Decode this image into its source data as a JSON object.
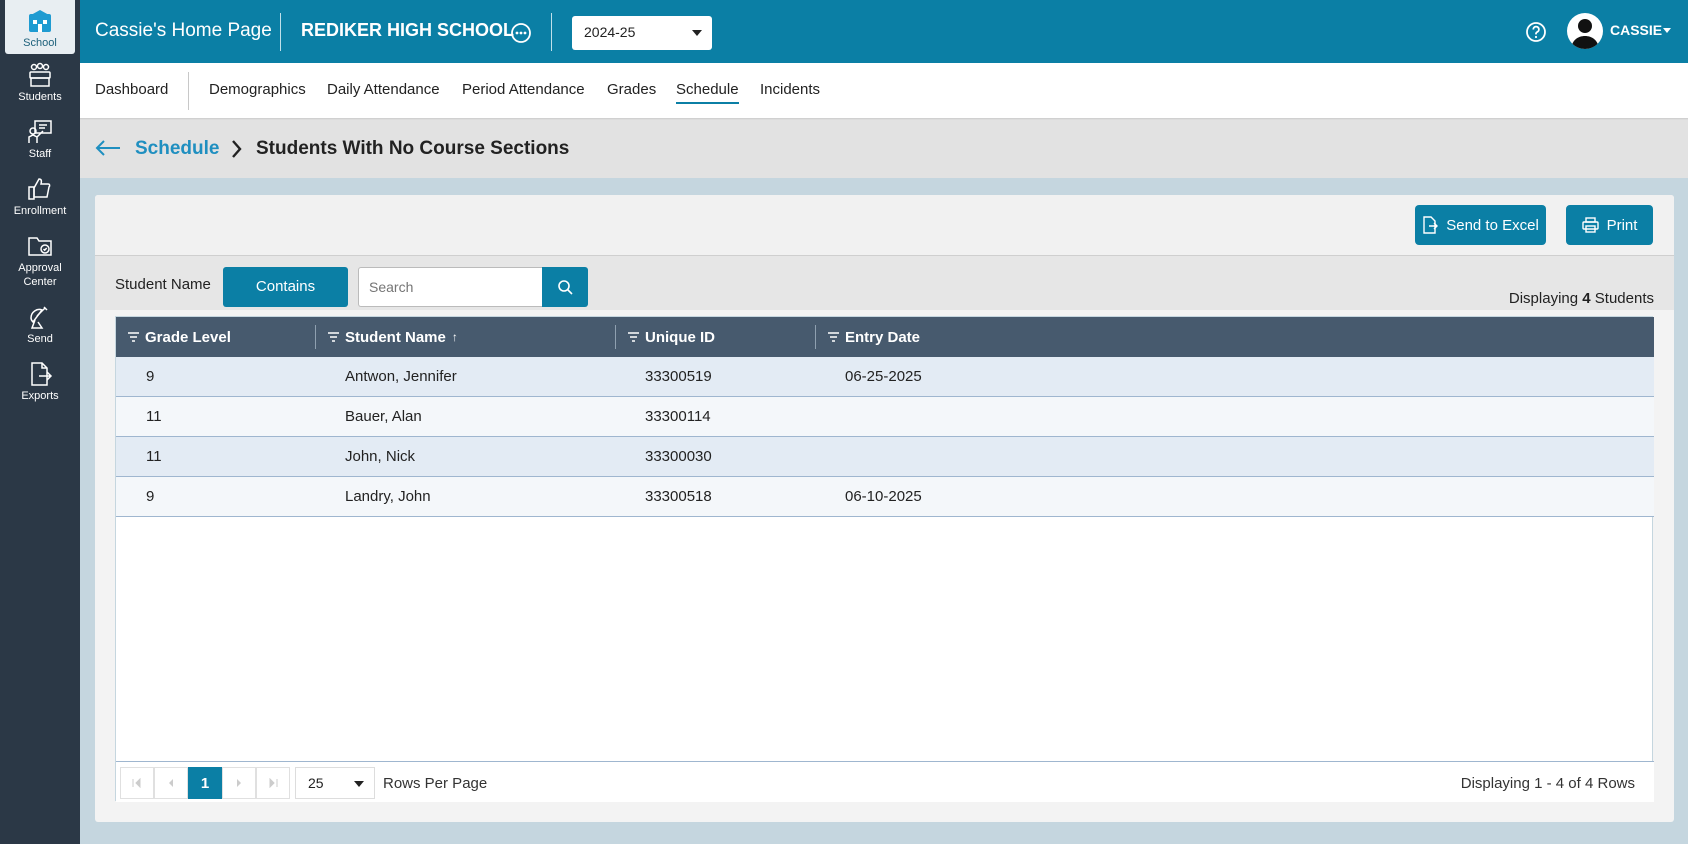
{
  "sidebar": {
    "items": [
      {
        "label": "School",
        "icon": "school-icon"
      },
      {
        "label": "Students",
        "icon": "students-icon"
      },
      {
        "label": "Staff",
        "icon": "staff-icon"
      },
      {
        "label": "Enrollment",
        "icon": "thumbs-up-icon"
      },
      {
        "label": "Approval Center",
        "label_line1": "Approval",
        "label_line2": "Center",
        "icon": "folder-icon"
      },
      {
        "label": "Send",
        "icon": "satellite-dish-icon"
      },
      {
        "label": "Exports",
        "icon": "file-export-icon"
      }
    ]
  },
  "header": {
    "home_title": "Cassie's Home Page",
    "school_name": "REDIKER HIGH SCHOOL",
    "school_year": "2024-25",
    "user_name": "CASSIE"
  },
  "tabs": {
    "items": [
      {
        "label": "Dashboard"
      },
      {
        "label": "Demographics"
      },
      {
        "label": "Daily Attendance"
      },
      {
        "label": "Period Attendance"
      },
      {
        "label": "Grades"
      },
      {
        "label": "Schedule"
      },
      {
        "label": "Incidents"
      }
    ],
    "active": "Schedule"
  },
  "breadcrumb": {
    "parent": "Schedule",
    "current": "Students With No Course Sections"
  },
  "toolbar": {
    "excel_label": "Send to Excel",
    "print_label": "Print"
  },
  "filter": {
    "label": "Student Name",
    "mode": "Contains",
    "placeholder": "Search",
    "displaying_prefix": "Displaying",
    "displaying_count": "4",
    "displaying_suffix": "Students"
  },
  "table": {
    "columns": [
      {
        "label": "Grade Level"
      },
      {
        "label": "Student Name",
        "sorted": "asc"
      },
      {
        "label": "Unique ID"
      },
      {
        "label": "Entry Date"
      }
    ],
    "sort_indicator": "↑",
    "rows": [
      {
        "grade": "9",
        "name": "Antwon, Jennifer",
        "id": "33300519",
        "entry": "06-25-2025"
      },
      {
        "grade": "11",
        "name": "Bauer, Alan",
        "id": "33300114",
        "entry": ""
      },
      {
        "grade": "11",
        "name": "John, Nick",
        "id": "33300030",
        "entry": ""
      },
      {
        "grade": "9",
        "name": "Landry, John",
        "id": "33300518",
        "entry": "06-10-2025"
      }
    ]
  },
  "pager": {
    "current_page": "1",
    "rows_per_page": "25",
    "rows_per_page_label": "Rows Per Page",
    "rows_info": "Displaying 1 - 4 of 4 Rows"
  },
  "colors": {
    "primary": "#0b7fa5",
    "sidebar": "#2b3846",
    "table_header": "#475a6e",
    "link": "#1f8fc0"
  }
}
